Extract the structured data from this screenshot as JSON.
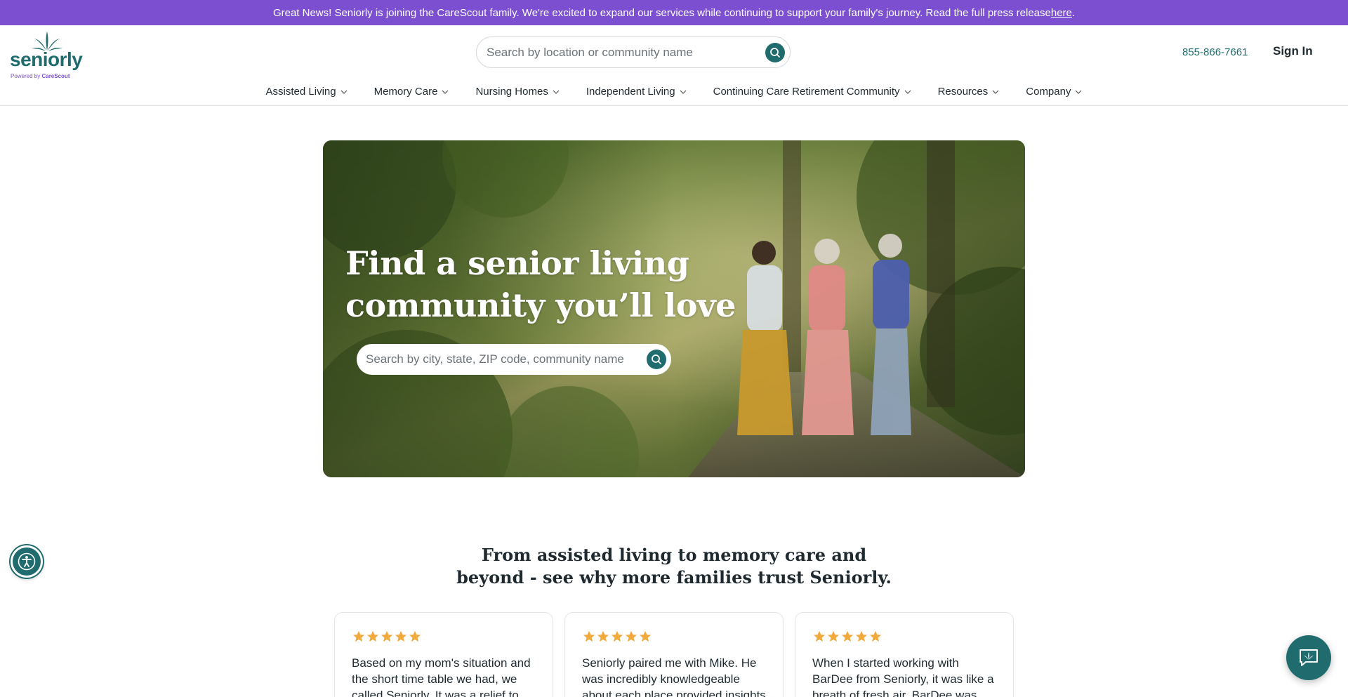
{
  "banner": {
    "text": "Great News! Seniorly is joining the CareScout family. We're excited to expand our services while continuing to support your family's journey. Read the full press release ",
    "link_label": "here",
    "end": "."
  },
  "header": {
    "logo_text": "seniorly",
    "logo_sub_prefix": "Powered by ",
    "logo_sub_brand": "CareScout",
    "search_placeholder": "Search by location or community name",
    "phone": "855-866-7661",
    "signin_label": "Sign In"
  },
  "nav": {
    "items": [
      {
        "label": "Assisted Living"
      },
      {
        "label": "Memory Care"
      },
      {
        "label": "Nursing Homes"
      },
      {
        "label": "Independent Living"
      },
      {
        "label": "Continuing Care Retirement Community"
      },
      {
        "label": "Resources"
      },
      {
        "label": "Company"
      }
    ]
  },
  "hero": {
    "title": "Find a senior living community you’ll love",
    "search_placeholder": "Search by city, state, ZIP code, community name"
  },
  "trust": {
    "heading_line1": "From assisted living to memory care and",
    "heading_line2": "beyond - see why more families trust Seniorly.",
    "reviews": [
      {
        "rating": 5,
        "text": "Based on my mom's situation and the short time table we had, we called Seniorly. It was a relief to"
      },
      {
        "rating": 5,
        "text": "Seniorly paired me with Mike. He was incredibly knowledgeable about each place provided insights"
      },
      {
        "rating": 5,
        "text": "When I started working with BarDee from Seniorly, it was like a breath of fresh air. BarDee was"
      }
    ]
  },
  "colors": {
    "banner": "#7b4fd0",
    "brand": "#1f6b6e",
    "star": "#f2a93b"
  }
}
